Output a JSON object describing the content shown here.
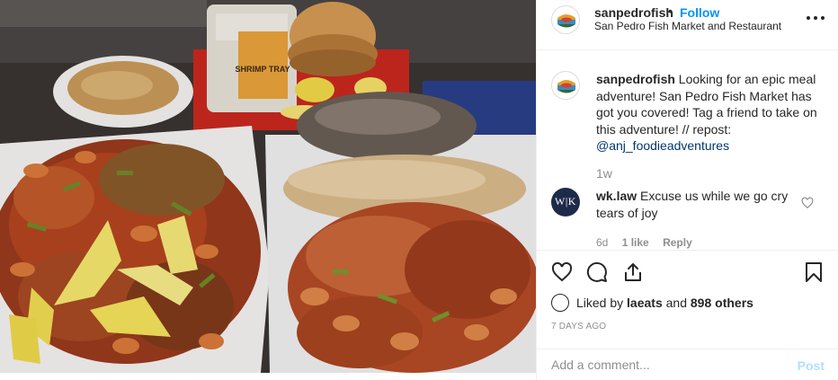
{
  "header": {
    "username": "sanpedrofish",
    "separator": "•",
    "follow_label": "Follow",
    "location": "San Pedro Fish Market and Restaurant"
  },
  "caption": {
    "username": "sanpedrofish",
    "text": "Looking for an epic meal adventure! San Pedro Fish Market has got you covered! Tag a friend to take on this adventure! // repost:",
    "mention": "@anj_foodieadventures",
    "time": "1w"
  },
  "comment": {
    "avatar_initials": "W|K",
    "username": "wk.law",
    "text": "Excuse us while we go cry tears of joy",
    "time": "6d",
    "likes": "1 like",
    "reply": "Reply"
  },
  "likes": {
    "prefix": "Liked by",
    "user": "laeats",
    "and": "and",
    "others": "898 others"
  },
  "date": "7 DAYS AGO",
  "add_comment": {
    "placeholder": "Add a comment...",
    "post_label": "Post"
  },
  "photo": {
    "cup_text": "SHRIMP TRAY"
  },
  "colors": {
    "follow": "#0095f6",
    "mention": "#00376b",
    "muted": "#8e8e8e",
    "post_disabled": "#b2dffc",
    "comment_avatar_bg": "#1d2a4a"
  },
  "icons": {
    "header_more": "more-horizontal-icon",
    "comment_like": "heart-outline-icon",
    "like": "heart-outline-icon",
    "comment": "speech-bubble-icon",
    "share": "share-icon",
    "save": "bookmark-icon"
  }
}
